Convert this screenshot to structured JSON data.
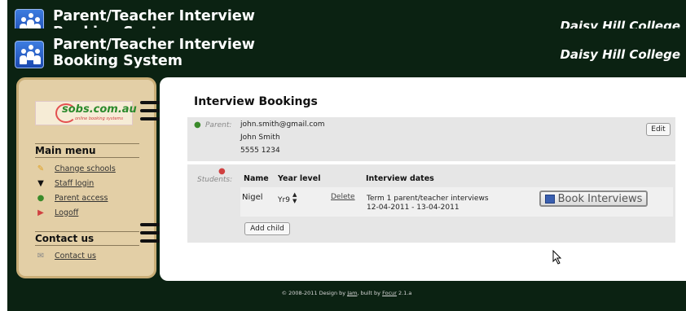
{
  "header": {
    "title_line1": "Parent/Teacher Interview",
    "title_line2": "Booking System",
    "school": "Daisy Hill College"
  },
  "sidebar": {
    "logo_text": "sobs.com.au",
    "logo_tagline": "online booking systems",
    "main_menu_heading": "Main menu",
    "menu_items": [
      {
        "label": "Change schools",
        "icon": "broom-icon"
      },
      {
        "label": "Staff login",
        "icon": "graduation-cap-icon"
      },
      {
        "label": "Parent access",
        "icon": "person-icon"
      },
      {
        "label": "Logoff",
        "icon": "logoff-icon"
      }
    ],
    "contact_heading": "Contact us",
    "contact_link": "Contact us"
  },
  "content": {
    "title": "Interview Bookings",
    "parent_label": "Parent:",
    "parent_email": "john.smith@gmail.com",
    "parent_name": "John Smith",
    "parent_phone": "5555 1234",
    "edit_button": "Edit",
    "students_label": "Students:",
    "columns": {
      "name": "Name",
      "year": "Year level",
      "dates": "Interview dates"
    },
    "student": {
      "name": "Nigel",
      "year": "Yr9",
      "delete_link": "Delete",
      "interview_title": "Term 1 parent/teacher interviews",
      "interview_range": "12-04-2011 - 13-04-2011"
    },
    "book_button": "Book Interviews",
    "add_child_button": "Add child"
  },
  "footer": {
    "text_prefix": "© 2008-2011 Design by",
    "designer": "Jam",
    "text_mid": ", built by",
    "builder": "Focur",
    "version": "2.1.a"
  }
}
